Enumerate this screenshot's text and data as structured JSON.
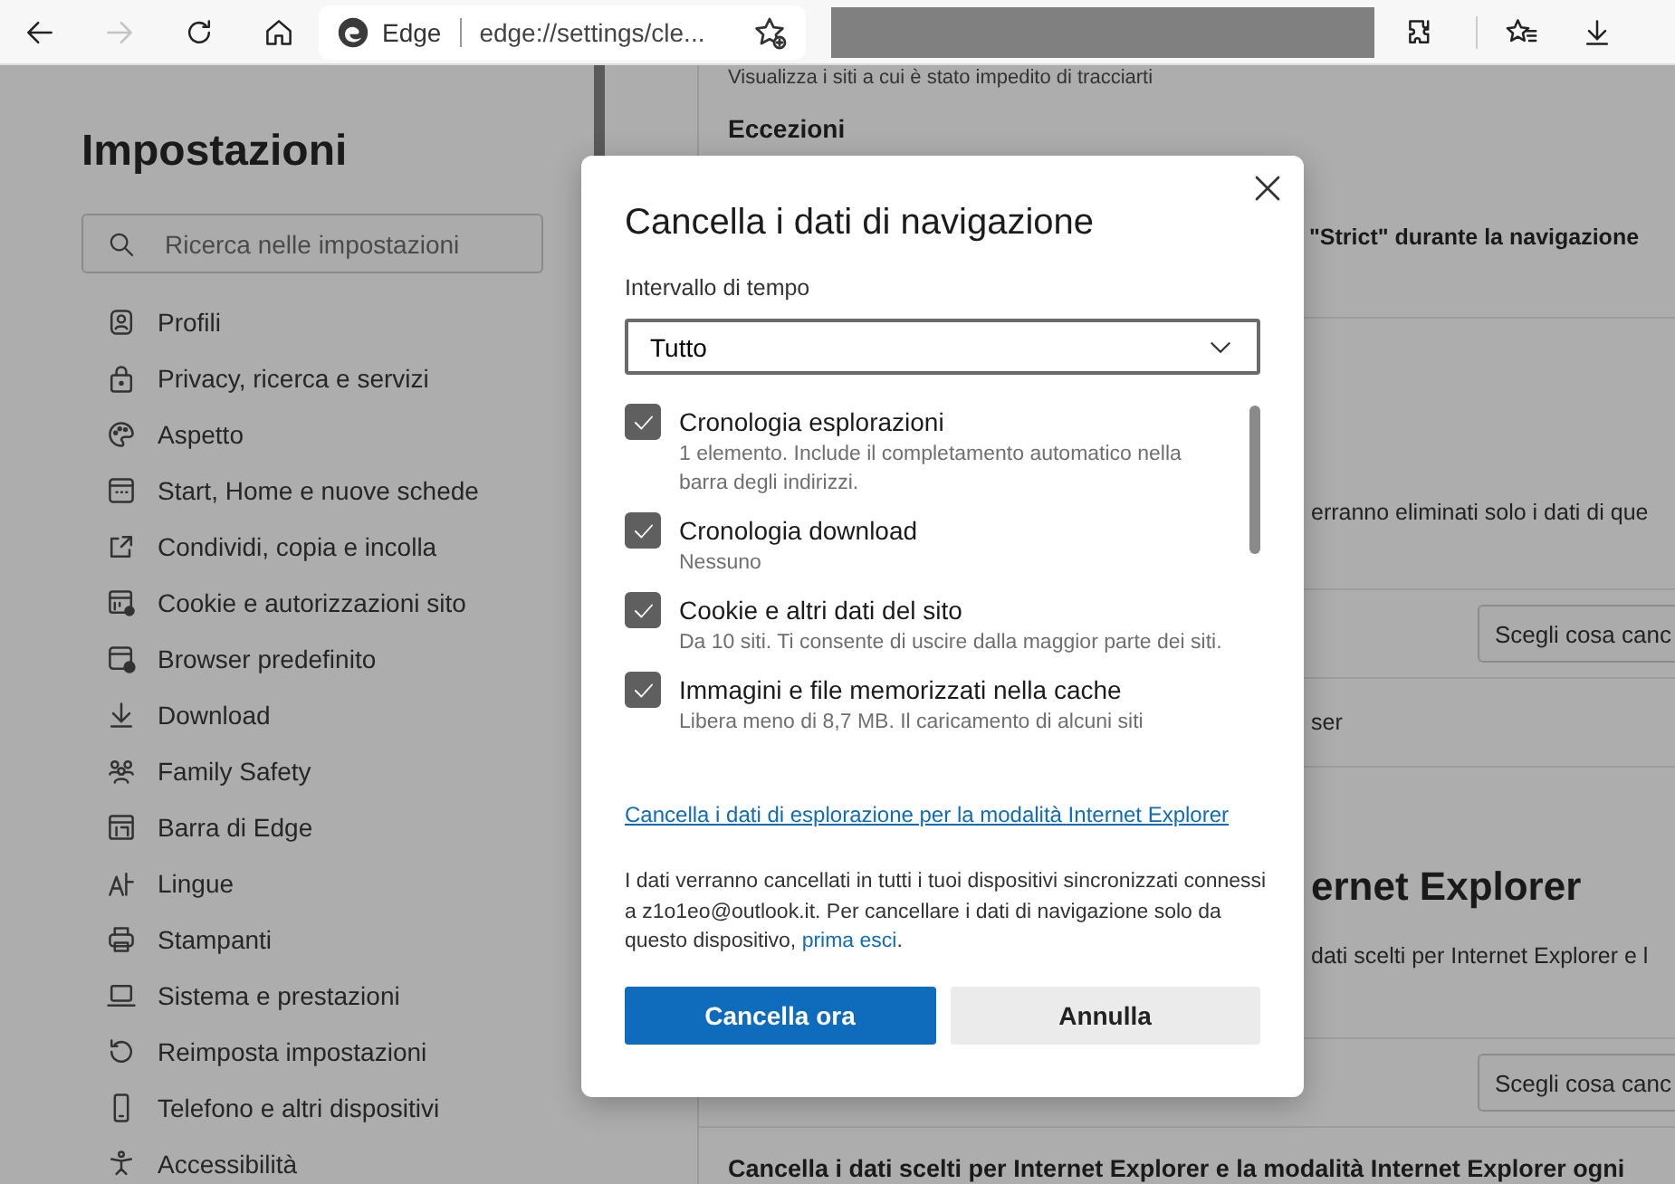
{
  "toolbar": {
    "forward_disabled": true,
    "site_label": "Edge",
    "url": "edge://settings/cle..."
  },
  "sidebar": {
    "title": "Impostazioni",
    "search": {
      "placeholder": "Ricerca nelle impostazioni"
    },
    "items": [
      {
        "label": "Profili"
      },
      {
        "label": "Privacy, ricerca e servizi"
      },
      {
        "label": "Aspetto"
      },
      {
        "label": "Start, Home e nuove schede"
      },
      {
        "label": "Condividi, copia e incolla"
      },
      {
        "label": "Cookie e autorizzazioni sito"
      },
      {
        "label": "Browser predefinito"
      },
      {
        "label": "Download"
      },
      {
        "label": "Family Safety"
      },
      {
        "label": "Barra di Edge"
      },
      {
        "label": "Lingue"
      },
      {
        "label": "Stampanti"
      },
      {
        "label": "Sistema e prestazioni"
      },
      {
        "label": "Reimposta impostazioni"
      },
      {
        "label": "Telefono e altri dispositivi"
      },
      {
        "label": "Accessibilità"
      }
    ]
  },
  "content": {
    "rows": [
      {
        "kind": "note",
        "text": "Visualizza i siti a cui è stato impedito di tracciarti"
      },
      {
        "kind": "label",
        "text": "Eccezioni"
      },
      {
        "kind": "label-partial",
        "text": "\"Strict\" durante la navigazione"
      },
      {
        "kind": "text-partial",
        "text": "erranno eliminati solo i dati di que"
      },
      {
        "kind": "button",
        "text": "Scegli cosa canc"
      },
      {
        "kind": "text-partial",
        "text": "ser"
      },
      {
        "kind": "heading-partial",
        "text": "ernet Explorer"
      },
      {
        "kind": "text-partial",
        "text": "dati scelti per Internet Explorer e l"
      },
      {
        "kind": "button",
        "text": "Scegli cosa canc"
      },
      {
        "kind": "label",
        "text": "Cancella i dati scelti per Internet Explorer e la modalità Internet Explorer ogni"
      }
    ]
  },
  "dialog": {
    "title": "Cancella i dati di navigazione",
    "range_label": "Intervallo di tempo",
    "range_value": "Tutto",
    "options": [
      {
        "label": "Cronologia esplorazioni",
        "description": "1 elemento. Include il completamento automatico nella barra degli indirizzi.",
        "checked": true
      },
      {
        "label": "Cronologia download",
        "description": "Nessuno",
        "checked": true
      },
      {
        "label": "Cookie e altri dati del sito",
        "description": "Da 10 siti. Ti consente di uscire dalla maggior parte dei siti.",
        "checked": true
      },
      {
        "label": "Immagini e file memorizzati nella cache",
        "description": "Libera meno di 8,7 MB. Il caricamento di alcuni siti",
        "checked": true
      }
    ],
    "ie_link": "Cancella i dati di esplorazione per la modalità Internet Explorer",
    "notice": "I dati verranno cancellati in tutti i tuoi dispositivi sincronizzati connessi a z1o1eo@outlook.it. Per cancellare i dati di navigazione solo da questo dispositivo,",
    "notice_link": "prima esci",
    "notice_end": ".",
    "buttons": [
      {
        "kind": "primary",
        "label": "Cancella ora"
      },
      {
        "kind": "secondary",
        "label": "Annulla"
      }
    ]
  }
}
